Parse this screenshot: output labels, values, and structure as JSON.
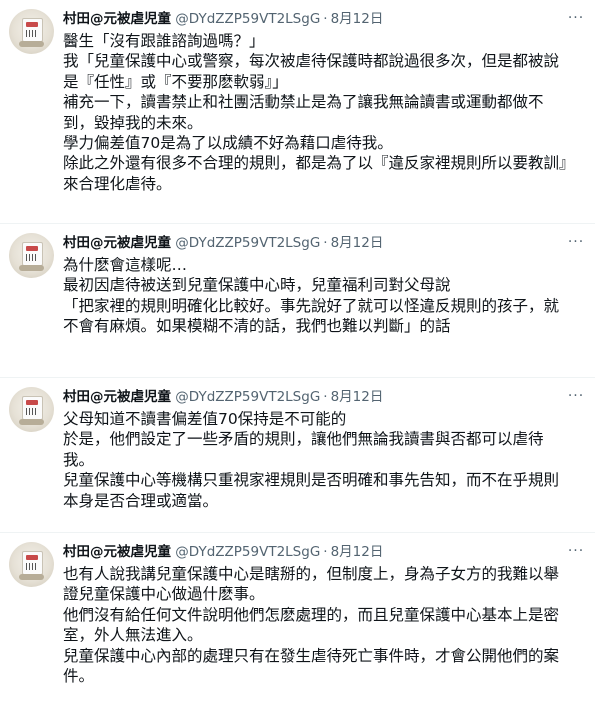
{
  "tweets": [
    {
      "display_name": "村田@元被虐児童",
      "handle": "@DYdZZP59VT2LSgG",
      "separator": "·",
      "date": "8月12日",
      "lines": [
        "醫生「沒有跟誰諮詢過嗎？」",
        "我「兒童保護中心或警察，每次被虐待保護時都說過很多次，但是都被說是『任性』或『不要那麽軟弱』」",
        "補充一下，讀書禁止和社團活動禁止是為了讓我無論讀書或運動都做不到，毀掉我的未來。",
        "學力偏差值70是為了以成績不好為藉口虐待我。",
        "除此之外還有很多不合理的規則，都是為了以『違反家裡規則所以要教訓』來合理化虐待。"
      ]
    },
    {
      "display_name": "村田@元被虐児童",
      "handle": "@DYdZZP59VT2LSgG",
      "separator": "·",
      "date": "8月12日",
      "lines": [
        "為什麽會這樣呢…",
        "最初因虐待被送到兒童保護中心時，兒童福利司對父母說",
        "「把家裡的規則明確化比較好。事先說好了就可以怪違反規則的孩子，就不會有麻煩。如果模糊不清的話，我們也難以判斷」的話"
      ]
    },
    {
      "display_name": "村田@元被虐児童",
      "handle": "@DYdZZP59VT2LSgG",
      "separator": "·",
      "date": "8月12日",
      "lines": [
        "父母知道不讀書偏差值70保持是不可能的",
        "於是，他們設定了一些矛盾的規則，讓他們無論我讀書與否都可以虐待我。",
        "兒童保護中心等機構只重視家裡規則是否明確和事先告知，而不在乎規則本身是否合理或適當。"
      ]
    },
    {
      "display_name": "村田@元被虐児童",
      "handle": "@DYdZZP59VT2LSgG",
      "separator": "·",
      "date": "8月12日",
      "lines": [
        "也有人說我講兒童保護中心是瞎掰的，但制度上，身為子女方的我難以舉證兒童保護中心做過什麽事。",
        "他們沒有給任何文件說明他們怎麽處理的，而且兒童保護中心基本上是密室，外人無法進入。",
        "兒童保護中心內部的處理只有在發生虐待死亡事件時，才會公開他們的案件。"
      ]
    }
  ]
}
